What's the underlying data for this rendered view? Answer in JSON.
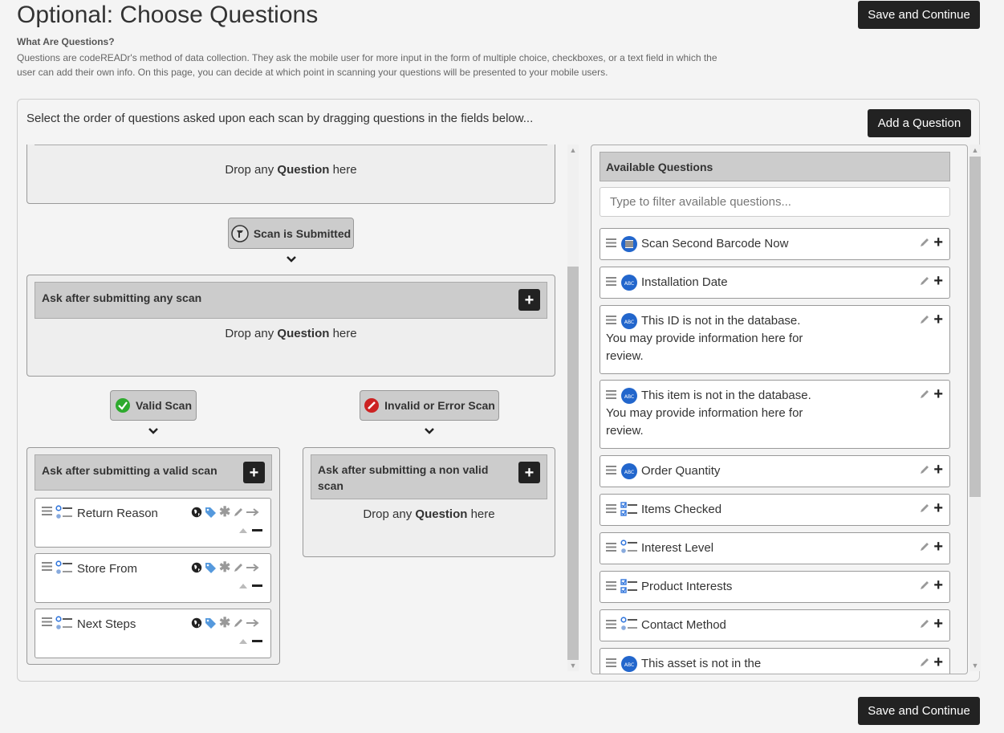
{
  "page": {
    "title": "Optional: Choose Questions",
    "save_label": "Save and Continue",
    "intro_heading": "What Are Questions?",
    "intro_text": "Questions are codeREADr's method of data collection. They ask the mobile user for more input in the form of multiple choice, checkboxes, or a text field in which the user can add their own info. On this page, you can decide at which point in scanning your questions will be presented to your mobile users."
  },
  "panel": {
    "instructions": "Select the order of questions asked upon each scan by dragging questions in the fields below...",
    "add_question_label": "Add a Question"
  },
  "flow": {
    "drop_prefix": "Drop any ",
    "drop_bold": "Question",
    "drop_suffix": " here",
    "scan_submitted_label": "Scan is Submitted",
    "any_scan_heading": "Ask after submitting any scan",
    "valid_scan_label": "Valid Scan",
    "invalid_scan_label": "Invalid or Error Scan",
    "valid_heading": "Ask after submitting a valid scan",
    "nonvalid_heading": "Ask after submitting a non valid scan",
    "valid_questions": [
      {
        "label": "Return Reason",
        "type": "multiple-choice"
      },
      {
        "label": "Store From",
        "type": "multiple-choice"
      },
      {
        "label": "Next Steps",
        "type": "multiple-choice"
      }
    ]
  },
  "available": {
    "heading": "Available Questions",
    "filter_placeholder": "Type to filter available questions...",
    "items": [
      {
        "label": "Scan Second Barcode Now",
        "type": "barcode"
      },
      {
        "label": "Installation Date",
        "type": "text"
      },
      {
        "label": "This ID is not in the database. You may provide information here for review.",
        "type": "text"
      },
      {
        "label": "This item is not in the database. You may provide information here for review.",
        "type": "text"
      },
      {
        "label": "Order Quantity",
        "type": "text"
      },
      {
        "label": "Items Checked",
        "type": "checkbox"
      },
      {
        "label": "Interest Level",
        "type": "multiple-choice"
      },
      {
        "label": "Product Interests",
        "type": "checkbox"
      },
      {
        "label": "Contact Method",
        "type": "multiple-choice"
      },
      {
        "label": "This asset is not in the database.",
        "type": "text"
      }
    ]
  },
  "colors": {
    "dark_button": "#222222",
    "valid_green": "#2eaa2e",
    "invalid_red": "#cc2222",
    "text_icon_blue": "#2266cc",
    "tag_blue": "#5599dd"
  }
}
